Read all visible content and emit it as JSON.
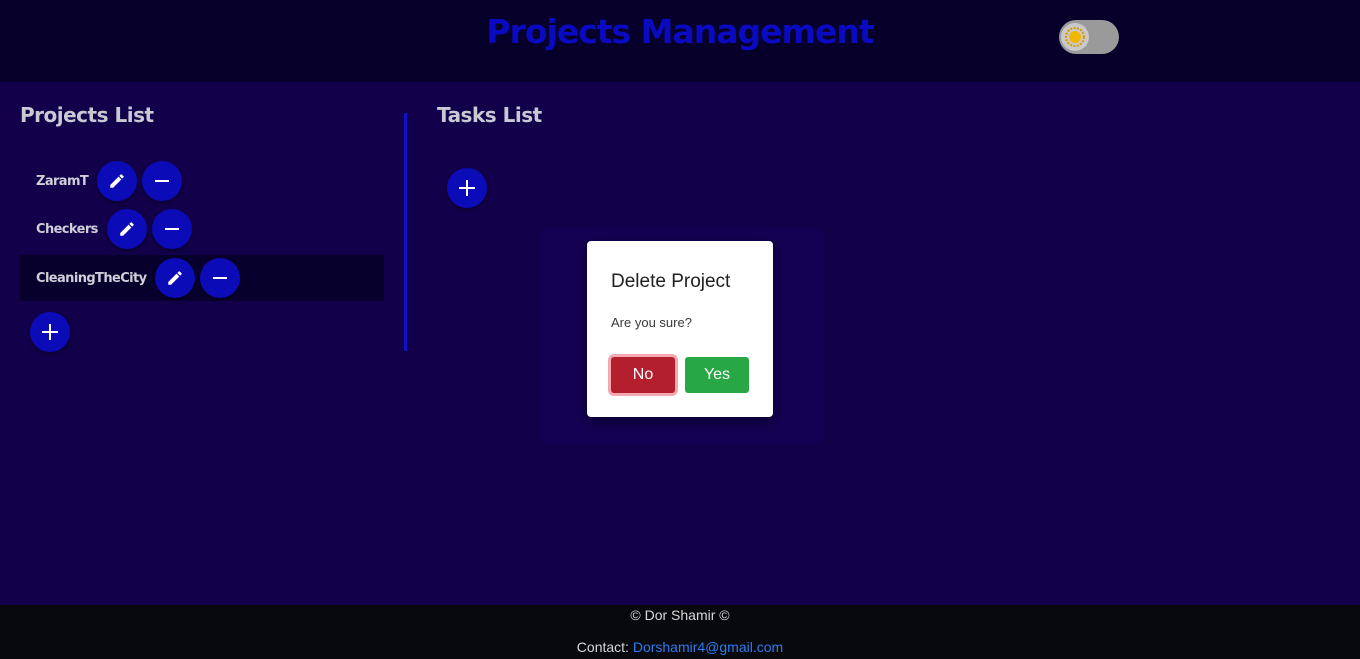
{
  "header": {
    "title": "Projects Management",
    "theme_toggle_icon": "sun-icon"
  },
  "projects": {
    "title": "Projects List",
    "items": [
      {
        "name": "ZaramT",
        "selected": false
      },
      {
        "name": "Checkers",
        "selected": false
      },
      {
        "name": "CleaningTheCity",
        "selected": true
      }
    ],
    "edit_icon": "pencil-icon",
    "delete_icon": "minus-icon",
    "add_icon": "plus-icon"
  },
  "tasks": {
    "title": "Tasks List",
    "add_icon": "plus-icon"
  },
  "modal": {
    "title": "Delete Project",
    "body": "Are you sure?",
    "no_label": "No",
    "yes_label": "Yes"
  },
  "footer": {
    "copyright": "© Dor Shamir ©",
    "contact_label": "Contact:",
    "contact_email": "Dorshamir4@gmail.com"
  },
  "colors": {
    "page_bg": "#12004a",
    "header_bg": "#07002a",
    "accent": "#0b0bb8",
    "danger": "#b41f2d",
    "success": "#28a745",
    "link": "#2b7cf0"
  }
}
